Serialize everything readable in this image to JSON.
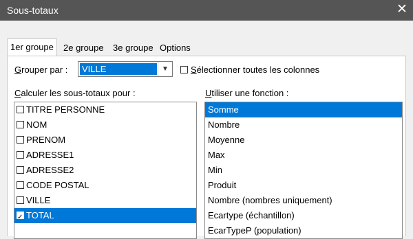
{
  "window": {
    "title": "Sous-totaux"
  },
  "tabs": [
    {
      "label": "1er groupe",
      "active": true
    },
    {
      "label": "2e groupe",
      "active": false
    },
    {
      "label": "3e groupe",
      "active": false
    },
    {
      "label": "Options",
      "active": false
    }
  ],
  "group": {
    "label_mnemonic": "G",
    "label_rest": "rouper par :",
    "value": "VILLE",
    "select_all_mnemonic": "S",
    "select_all_rest": "électionner toutes les colonnes",
    "select_all_checked": false
  },
  "fields": {
    "label_mnemonic": "C",
    "label_rest": "alculer les sous-totaux pour :",
    "items": [
      {
        "label": "TITRE PERSONNE",
        "checked": false,
        "selected": false
      },
      {
        "label": "NOM",
        "checked": false,
        "selected": false
      },
      {
        "label": "PRENOM",
        "checked": false,
        "selected": false
      },
      {
        "label": "ADRESSE1",
        "checked": false,
        "selected": false
      },
      {
        "label": "ADRESSE2",
        "checked": false,
        "selected": false
      },
      {
        "label": "CODE POSTAL",
        "checked": false,
        "selected": false
      },
      {
        "label": "VILLE",
        "checked": false,
        "selected": false
      },
      {
        "label": "TOTAL",
        "checked": true,
        "selected": true
      }
    ]
  },
  "functions": {
    "label_mnemonic": "U",
    "label_rest": "tiliser une fonction :",
    "items": [
      {
        "label": "Somme",
        "selected": true
      },
      {
        "label": "Nombre",
        "selected": false
      },
      {
        "label": "Moyenne",
        "selected": false
      },
      {
        "label": "Max",
        "selected": false
      },
      {
        "label": "Min",
        "selected": false
      },
      {
        "label": "Produit",
        "selected": false
      },
      {
        "label": "Nombre (nombres uniquement)",
        "selected": false
      },
      {
        "label": "Ecartype (échantillon)",
        "selected": false
      },
      {
        "label": "EcarTypeP (population)",
        "selected": false
      }
    ]
  },
  "colors": {
    "titlebar": "#555555",
    "selection": "#0078d7"
  }
}
